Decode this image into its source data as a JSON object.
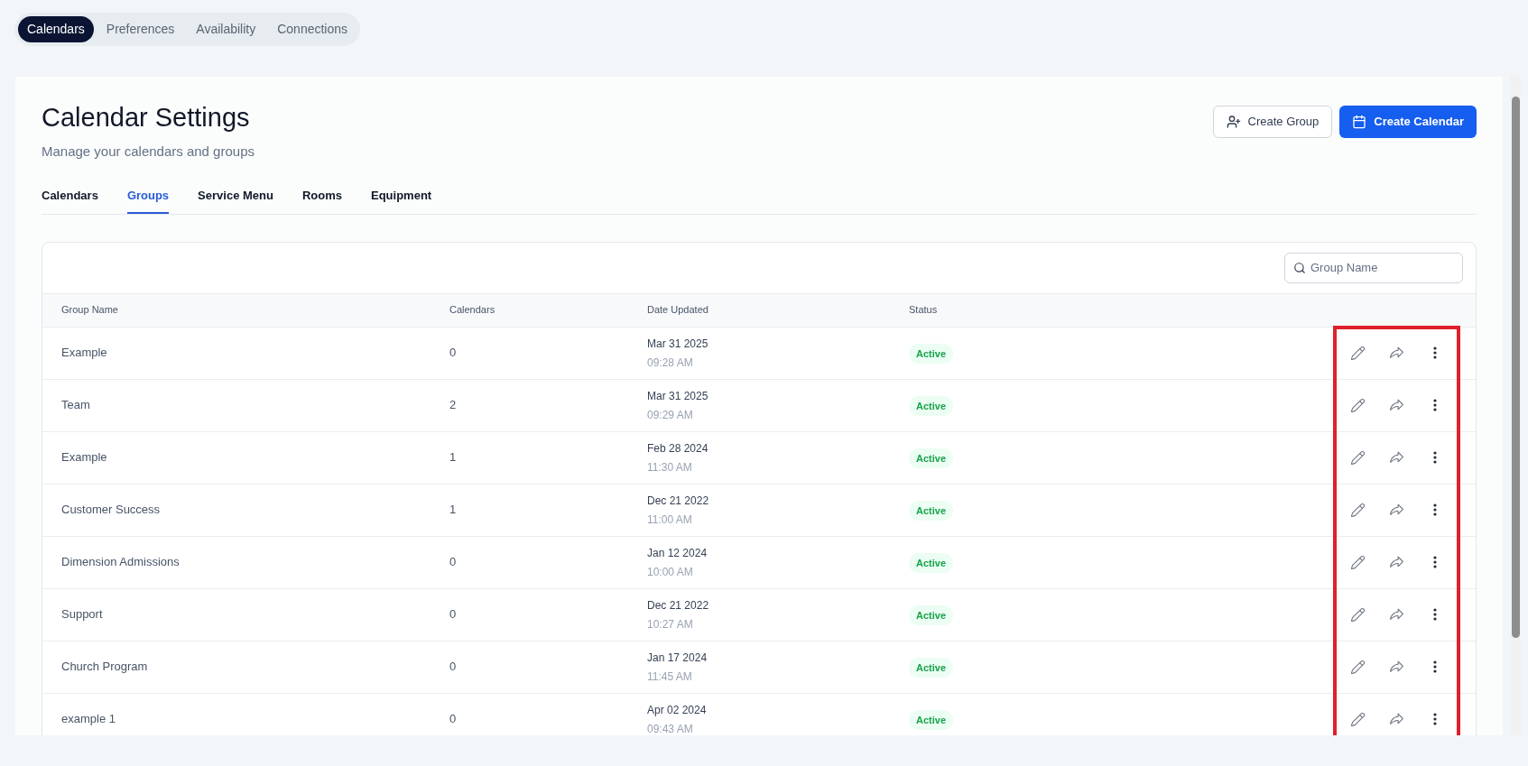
{
  "top_tabs": [
    {
      "label": "Calendars",
      "selected": true
    },
    {
      "label": "Preferences",
      "selected": false
    },
    {
      "label": "Availability",
      "selected": false
    },
    {
      "label": "Connections",
      "selected": false
    }
  ],
  "header": {
    "title": "Calendar Settings",
    "subtitle": "Manage your calendars and groups",
    "buttons": [
      {
        "label": "Create Group",
        "kind": "secondary"
      },
      {
        "label": "Create Calendar",
        "kind": "primary"
      }
    ]
  },
  "tabs": [
    {
      "label": "Calendars",
      "selected": false
    },
    {
      "label": "Groups",
      "selected": true
    },
    {
      "label": "Service Menu",
      "selected": false
    },
    {
      "label": "Rooms",
      "selected": false
    },
    {
      "label": "Equipment",
      "selected": false
    }
  ],
  "search": {
    "placeholder": "Group Name"
  },
  "table": {
    "columns": [
      "Group Name",
      "Calendars",
      "Date Updated",
      "Status"
    ],
    "rows": [
      {
        "name": "Example",
        "calendars": "0",
        "date": "Mar 31 2025",
        "time": "09:28 AM",
        "status": "Active"
      },
      {
        "name": "Team",
        "calendars": "2",
        "date": "Mar 31 2025",
        "time": "09:29 AM",
        "status": "Active"
      },
      {
        "name": "Example",
        "calendars": "1",
        "date": "Feb 28 2024",
        "time": "11:30 AM",
        "status": "Active"
      },
      {
        "name": "Customer Success",
        "calendars": "1",
        "date": "Dec 21 2022",
        "time": "11:00 AM",
        "status": "Active"
      },
      {
        "name": "Dimension Admissions",
        "calendars": "0",
        "date": "Jan 12 2024",
        "time": "10:00 AM",
        "status": "Active"
      },
      {
        "name": "Support",
        "calendars": "0",
        "date": "Dec 21 2022",
        "time": "10:27 AM",
        "status": "Active"
      },
      {
        "name": "Church Program",
        "calendars": "0",
        "date": "Jan 17 2024",
        "time": "11:45 AM",
        "status": "Active"
      },
      {
        "name": "example 1",
        "calendars": "0",
        "date": "Apr 02 2024",
        "time": "09:43 AM",
        "status": "Active"
      }
    ]
  }
}
